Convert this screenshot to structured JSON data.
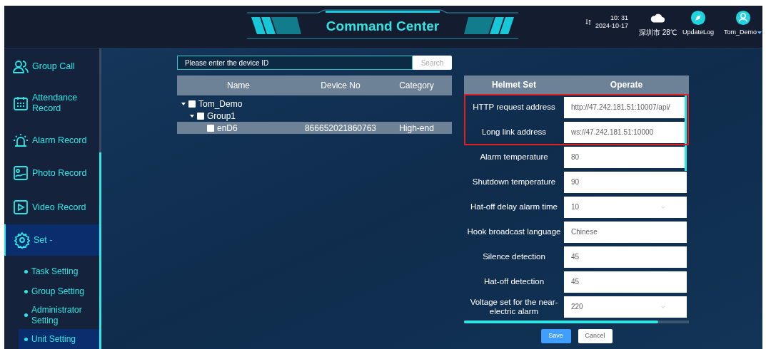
{
  "header": {
    "title": "Command Center",
    "time": "10: 31",
    "date": "2024-10-17",
    "weather": "深圳市 28℃",
    "update_log": "UpdateLog",
    "user": "Tom_Demo"
  },
  "sidebar": {
    "items": [
      {
        "label": "Group Call",
        "selected": false
      },
      {
        "label": "Attendance Record",
        "selected": false
      },
      {
        "label": "Alarm Record",
        "selected": false
      },
      {
        "label": "Photo Record",
        "selected": false
      },
      {
        "label": "Video Record",
        "selected": false
      },
      {
        "label": "Set -",
        "selected": true,
        "children": [
          {
            "label": "Task Setting",
            "selected": false
          },
          {
            "label": "Group Setting",
            "selected": false
          },
          {
            "label": "Administrator Setting",
            "selected": false
          },
          {
            "label": "Unit Setting",
            "selected": true
          }
        ]
      }
    ]
  },
  "search": {
    "placeholder": "Please enter the device ID",
    "button": "Search"
  },
  "device_table": {
    "columns": [
      "Name",
      "Device No",
      "Category"
    ],
    "rows": [
      {
        "name": "Tom_Demo",
        "checked": false,
        "expanded": true,
        "selected": false,
        "children": [
          {
            "name": "Group1",
            "checked": false,
            "expanded": true,
            "selected": false,
            "children": [
              {
                "name": "enD6",
                "device_no": "866652021860763",
                "category": "High-end",
                "checked": false,
                "selected": true
              }
            ]
          }
        ]
      }
    ]
  },
  "settings": {
    "columns": [
      "Helmet Set",
      "Operate"
    ],
    "rows": [
      {
        "label": "HTTP request address",
        "value": "http://47.242.181.51:10007/api/",
        "kind": "input",
        "highlighted": true
      },
      {
        "label": "Long link address",
        "value": "ws://47.242.181.51:10000",
        "kind": "input",
        "highlighted": true
      },
      {
        "label": "Alarm temperature",
        "value": "80",
        "kind": "input",
        "highlighted": false
      },
      {
        "label": "Shutdown temperature",
        "value": "90",
        "kind": "input",
        "highlighted": false
      },
      {
        "label": "Hat-off delay alarm time",
        "value": "10",
        "kind": "select",
        "highlighted": false
      },
      {
        "label": "Hook broadcast language",
        "value": "Chinese",
        "kind": "input",
        "highlighted": false
      },
      {
        "label": "Silence detection",
        "value": "45",
        "kind": "input",
        "highlighted": false
      },
      {
        "label": "Hat-off detection",
        "value": "45",
        "kind": "input",
        "highlighted": false
      },
      {
        "label": "Voltage set for the near-electric alarm",
        "value": "220",
        "kind": "select",
        "highlighted": false
      }
    ],
    "save": "Save",
    "cancel": "Cancel"
  }
}
